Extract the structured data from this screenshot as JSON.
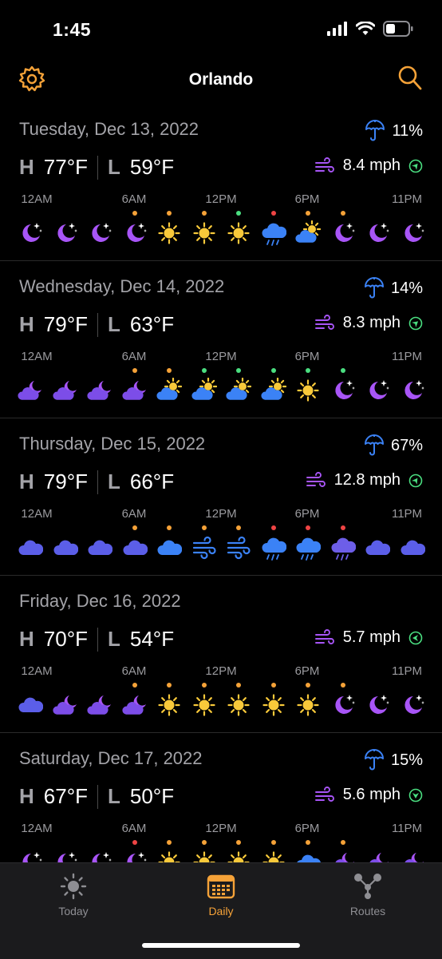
{
  "status": {
    "time": "1:45"
  },
  "header": {
    "city": "Orlando"
  },
  "colors": {
    "accent": "#f5a238",
    "moon": "#a855f7",
    "sun": "#f8c93a",
    "cloud": "#5b5ee8",
    "rain_cloud": "#3b82f6",
    "umbrella": "#3b82f6",
    "wind": "#a855f7",
    "arrow": "#4ade80",
    "dot_orange": "#f5a238",
    "dot_green": "#4ade80",
    "dot_red": "#ef4444"
  },
  "tick_labels": [
    "12AM",
    "6AM",
    "12PM",
    "6PM",
    "11PM"
  ],
  "days": [
    {
      "date": "Tuesday, Dec 13, 2022",
      "rain": "11%",
      "high_label": "H",
      "high": "77°F",
      "low_label": "L",
      "low": "59°F",
      "wind": "8.4 mph",
      "hours": [
        {
          "icon": "moon-stars",
          "dot": null
        },
        {
          "icon": "moon-stars",
          "dot": null
        },
        {
          "icon": "moon-stars",
          "dot": null
        },
        {
          "icon": "moon-stars",
          "dot": "orange"
        },
        {
          "icon": "sun",
          "dot": "orange"
        },
        {
          "icon": "sun",
          "dot": "orange"
        },
        {
          "icon": "sun",
          "dot": "green"
        },
        {
          "icon": "cloud-rain",
          "dot": "red"
        },
        {
          "icon": "cloud-sun",
          "dot": "orange"
        },
        {
          "icon": "moon-stars",
          "dot": "orange"
        },
        {
          "icon": "moon-stars",
          "dot": null
        },
        {
          "icon": "moon-stars",
          "dot": null
        }
      ]
    },
    {
      "date": "Wednesday, Dec 14, 2022",
      "rain": "14%",
      "high_label": "H",
      "high": "79°F",
      "low_label": "L",
      "low": "63°F",
      "wind": "8.3 mph",
      "hours": [
        {
          "icon": "cloud-moon",
          "dot": null
        },
        {
          "icon": "cloud-moon",
          "dot": null
        },
        {
          "icon": "cloud-moon",
          "dot": null
        },
        {
          "icon": "cloud-moon",
          "dot": "orange"
        },
        {
          "icon": "cloud-sun",
          "dot": "orange"
        },
        {
          "icon": "cloud-sun",
          "dot": "green"
        },
        {
          "icon": "cloud-sun",
          "dot": "green"
        },
        {
          "icon": "cloud-sun",
          "dot": "green"
        },
        {
          "icon": "sun",
          "dot": "green"
        },
        {
          "icon": "moon-stars",
          "dot": "green"
        },
        {
          "icon": "moon-stars",
          "dot": null
        },
        {
          "icon": "moon-stars",
          "dot": null
        }
      ]
    },
    {
      "date": "Thursday, Dec 15, 2022",
      "rain": "67%",
      "high_label": "H",
      "high": "79°F",
      "low_label": "L",
      "low": "66°F",
      "wind": "12.8 mph",
      "hours": [
        {
          "icon": "cloud",
          "dot": null
        },
        {
          "icon": "cloud",
          "dot": null
        },
        {
          "icon": "cloud",
          "dot": null
        },
        {
          "icon": "cloud",
          "dot": "orange"
        },
        {
          "icon": "cloud-blue",
          "dot": "orange"
        },
        {
          "icon": "wind",
          "dot": "orange"
        },
        {
          "icon": "wind",
          "dot": "orange"
        },
        {
          "icon": "cloud-rain",
          "dot": "red"
        },
        {
          "icon": "cloud-rain",
          "dot": "red"
        },
        {
          "icon": "cloud-rain-purple",
          "dot": "red"
        },
        {
          "icon": "cloud",
          "dot": null
        },
        {
          "icon": "cloud",
          "dot": null
        }
      ]
    },
    {
      "date": "Friday, Dec 16, 2022",
      "rain": "",
      "high_label": "H",
      "high": "70°F",
      "low_label": "L",
      "low": "54°F",
      "wind": "5.7 mph",
      "hours": [
        {
          "icon": "cloud",
          "dot": null
        },
        {
          "icon": "cloud-moon",
          "dot": null
        },
        {
          "icon": "cloud-moon",
          "dot": null
        },
        {
          "icon": "cloud-moon",
          "dot": "orange"
        },
        {
          "icon": "sun",
          "dot": "orange"
        },
        {
          "icon": "sun",
          "dot": "orange"
        },
        {
          "icon": "sun",
          "dot": "orange"
        },
        {
          "icon": "sun",
          "dot": "orange"
        },
        {
          "icon": "sun",
          "dot": "orange"
        },
        {
          "icon": "moon-stars",
          "dot": "orange"
        },
        {
          "icon": "moon-stars",
          "dot": null
        },
        {
          "icon": "moon-stars",
          "dot": null
        }
      ]
    },
    {
      "date": "Saturday, Dec 17, 2022",
      "rain": "15%",
      "high_label": "H",
      "high": "67°F",
      "low_label": "L",
      "low": "50°F",
      "wind": "5.6 mph",
      "hours": [
        {
          "icon": "moon-stars",
          "dot": null
        },
        {
          "icon": "moon-stars",
          "dot": null
        },
        {
          "icon": "moon-stars",
          "dot": null
        },
        {
          "icon": "moon-stars",
          "dot": "red"
        },
        {
          "icon": "sun",
          "dot": "orange"
        },
        {
          "icon": "sun",
          "dot": "orange"
        },
        {
          "icon": "sun",
          "dot": "orange"
        },
        {
          "icon": "sun",
          "dot": "orange"
        },
        {
          "icon": "cloud-blue",
          "dot": "orange"
        },
        {
          "icon": "cloud-moon",
          "dot": "orange"
        },
        {
          "icon": "cloud-moon",
          "dot": null
        },
        {
          "icon": "cloud-moon",
          "dot": null
        }
      ]
    }
  ],
  "tabs": [
    {
      "label": "Today",
      "icon": "sun-icon",
      "active": false
    },
    {
      "label": "Daily",
      "icon": "calendar-icon",
      "active": true
    },
    {
      "label": "Routes",
      "icon": "routes-icon",
      "active": false
    }
  ]
}
